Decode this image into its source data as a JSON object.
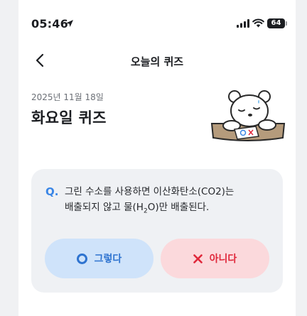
{
  "status_bar": {
    "time": "05:46",
    "battery": "64",
    "icons": [
      "location-arrow-icon",
      "cellular-signal-icon",
      "wifi-icon",
      "battery-icon"
    ]
  },
  "nav": {
    "title": "오늘의 퀴즈",
    "back_icon": "chevron-left-icon"
  },
  "header": {
    "date": "2025년 11월 18일",
    "day_title": "화요일 퀴즈",
    "illustration": "sleepy-bear-illustration"
  },
  "quiz": {
    "q_mark": "Q.",
    "question_line1": "그린 수소를 사용하면 이산화탄소(CO2)는",
    "question_line2_pre": "배출되지 않고 물(H",
    "question_line2_sub": "2",
    "question_line2_post": "O)만 배출된다.",
    "answers": {
      "yes_label": "그렇다",
      "no_label": "아니다"
    }
  },
  "colors": {
    "accent_blue": "#2f74d0",
    "accent_red": "#e0283b",
    "card_bg": "#eff1f4",
    "yes_bg": "#cfe3fa",
    "no_bg": "#fbd9dc"
  }
}
